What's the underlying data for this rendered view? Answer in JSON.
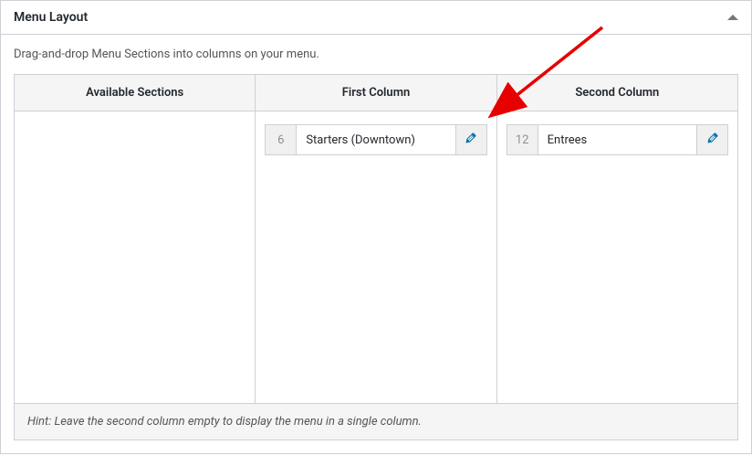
{
  "panel": {
    "title": "Menu Layout",
    "instructions": "Drag-and-drop Menu Sections into columns on your menu.",
    "hint": "Hint: Leave the second column empty to display the menu in a single column."
  },
  "columns": {
    "available": {
      "header": "Available Sections"
    },
    "first": {
      "header": "First Column"
    },
    "second": {
      "header": "Second Column"
    }
  },
  "sections": {
    "first": [
      {
        "count": "6",
        "label": "Starters (Downtown)"
      }
    ],
    "second": [
      {
        "count": "12",
        "label": "Entrees"
      }
    ]
  }
}
